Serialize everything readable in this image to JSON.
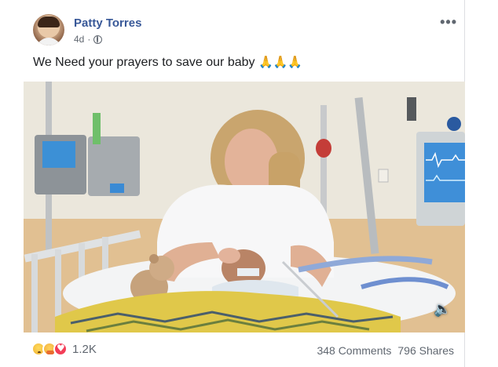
{
  "post": {
    "author": "Patty Torres",
    "time": "4d",
    "more_label": "•••",
    "text": "We Need your prayers to save our baby",
    "emoji": "🙏🙏🙏",
    "audience_icon": "globe-icon"
  },
  "media": {
    "mute_icon": "speaker-muted-icon"
  },
  "footer": {
    "reaction_icons": [
      "sad-reaction-icon",
      "care-reaction-icon",
      "love-reaction-icon"
    ],
    "reaction_count": "1.2K",
    "comments": "348 Comments",
    "shares": "796 Shares"
  },
  "colors": {
    "author_link": "#385898",
    "meta_text": "#606770",
    "love": "#f33e58"
  }
}
